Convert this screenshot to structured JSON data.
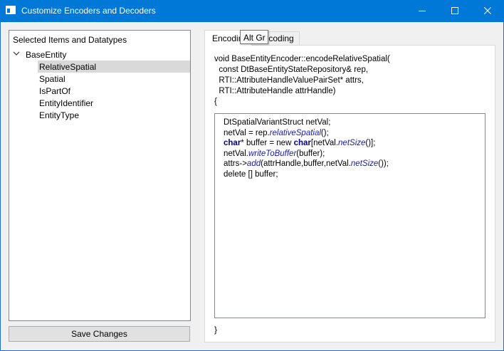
{
  "window": {
    "title": "Customize Encoders and Decoders",
    "titlebar_color": "#0078d7"
  },
  "tree": {
    "header": "Selected Items and Datatypes",
    "root": "BaseEntity",
    "children": [
      "RelativeSpatial",
      "Spatial",
      "IsPartOf",
      "EntityIdentifier",
      "EntityType"
    ],
    "selected": "RelativeSpatial"
  },
  "save_button": "Save Changes",
  "tabs": {
    "encoding": "Encoding",
    "decoding": "Decoding"
  },
  "tooltip": "Alt Gr",
  "signature": [
    "void BaseEntityEncoder::encodeRelativeSpatial(",
    "  const DtBaseEntityStateRepository& rep,",
    "  RTI::AttributeHandleValuePairSet* attrs,",
    "  RTI::AttributeHandle attrHandle)",
    "{"
  ],
  "code": {
    "line1": "DtSpatialVariantStruct netVal;",
    "line2a": "netVal = rep.",
    "line2fn": "relativeSpatial",
    "line2b": "();",
    "line3kw1": "char",
    "line3a": "* buffer = new ",
    "line3kw2": "char",
    "line3b": "[netVal.",
    "line3fn": "netSize",
    "line3c": "()];",
    "line4a": "netVal.",
    "line4fn": "writeToBuffer",
    "line4b": "(buffer);",
    "line5a": "attrs->",
    "line5fn1": "add",
    "line5b": "(attrHandle,buffer,netVal.",
    "line5fn2": "netSize",
    "line5c": "());",
    "line6": "delete [] buffer;"
  },
  "closing_brace": "}"
}
